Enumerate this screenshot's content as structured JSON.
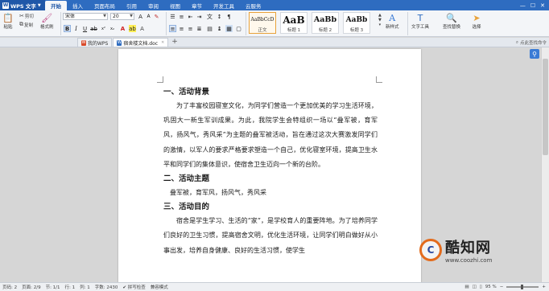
{
  "app": {
    "name": "WPS 文字"
  },
  "menu": {
    "tabs": [
      "开始",
      "插入",
      "页面布局",
      "引用",
      "审阅",
      "视图",
      "章节",
      "开发工具",
      "云服务"
    ],
    "active_index": 0
  },
  "ribbon": {
    "paste": "粘贴",
    "cut": "剪切",
    "copy": "复制",
    "format_painter": "格式刷",
    "font_name": "宋体",
    "font_size": "20",
    "styles": [
      {
        "sample": "AaBbCcD",
        "name": "正文"
      },
      {
        "sample": "AaB",
        "name": "标题 1"
      },
      {
        "sample": "AaBb",
        "name": "标题 2"
      },
      {
        "sample": "AaBb",
        "name": "标题 3"
      }
    ],
    "new_style": "新样式",
    "text_tools": "文字工具",
    "find_replace": "查找替换",
    "select": "选择"
  },
  "tabs": {
    "items": [
      {
        "label": "我的WPS",
        "active": false
      },
      {
        "label": "宿舍楼文档.doc",
        "active": true
      }
    ],
    "right_label": "点此查找命令"
  },
  "document": {
    "blocks": [
      {
        "type": "h",
        "text": "一、活动背景"
      },
      {
        "type": "p",
        "text": "为了丰富校园寝室文化，为同学们营造一个更加优美的学习生活环境，巩固大一新生军训成果。为此，我院学生会特组织一场以“叠军被，育军风，扬风气，秀风采”为主题的叠军被活动，旨在通过这次大赛激发同学们的激情，以军人的要求严格要求塑造一个自己，优化寝室环境，提高卫生水平和同学们的集体意识，使宿舍卫生迈向一个新的台阶。"
      },
      {
        "type": "h",
        "text": "二、活动主题"
      },
      {
        "type": "pn",
        "text": "叠军被，育军风，扬风气，秀风采"
      },
      {
        "type": "h",
        "text": "三、活动目的"
      },
      {
        "type": "p",
        "text": "宿舍是学生学习、生活的“家”，是学校育人的重要阵地。为了培养同学们良好的卫生习惯，提高宿舍文明，优化生活环境，让同学们明白做好从小事出发，培养自身健康、良好的生活习惯，使学生"
      }
    ]
  },
  "watermark": {
    "name": "酷知网",
    "url": "www.coozhi.com"
  },
  "status": {
    "page": "页码: 2",
    "pages": "页面: 2/9",
    "section": "节: 1/1",
    "row": "行: 1",
    "col": "列: 1",
    "words": "字数: 2430",
    "spell": "拼写检查",
    "compat": "兼容模式",
    "zoom": "95 %"
  },
  "colors": {
    "menubar": "#2e6cc0",
    "accent": "#e36b1c"
  }
}
